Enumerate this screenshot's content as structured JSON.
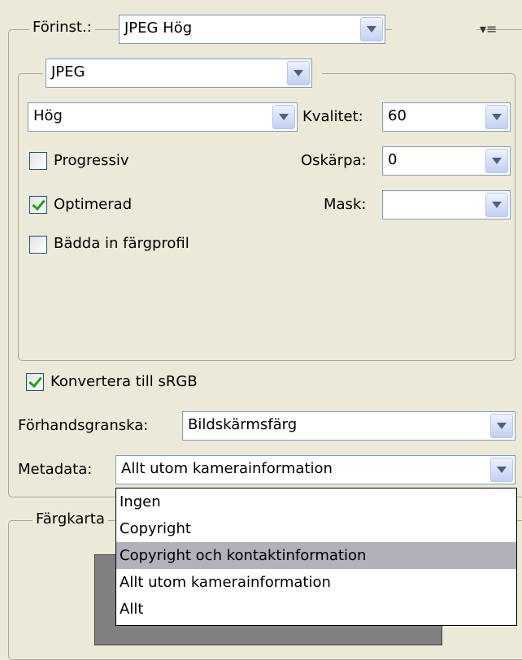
{
  "preset": {
    "label": "Förinst.:",
    "value": "JPEG Hög",
    "menu_icon": "panel-menu-icon"
  },
  "format": {
    "value": "JPEG"
  },
  "quality_preset": {
    "value": "Hög"
  },
  "quality": {
    "label": "Kvalitet:",
    "value": "60"
  },
  "blur": {
    "label": "Oskärpa:",
    "value": "0"
  },
  "mask": {
    "label": "Mask:",
    "value": ""
  },
  "progressive": {
    "label": "Progressiv",
    "checked": false
  },
  "optimized": {
    "label": "Optimerad",
    "checked": true
  },
  "embed_profile": {
    "label": "Bädda in färgprofil",
    "checked": false
  },
  "convert_srgb": {
    "label": "Konvertera till sRGB",
    "checked": true
  },
  "preview": {
    "label": "Förhandsgranska:",
    "value": "Bildskärmsfärg"
  },
  "metadata": {
    "label": "Metadata:",
    "value": "Allt utom kamerainformation",
    "options": [
      "Ingen",
      "Copyright",
      "Copyright och kontaktinformation",
      "Allt utom kamerainformation",
      "Allt"
    ],
    "highlighted_index": 2
  },
  "color_table": {
    "label": "Färgkarta"
  }
}
